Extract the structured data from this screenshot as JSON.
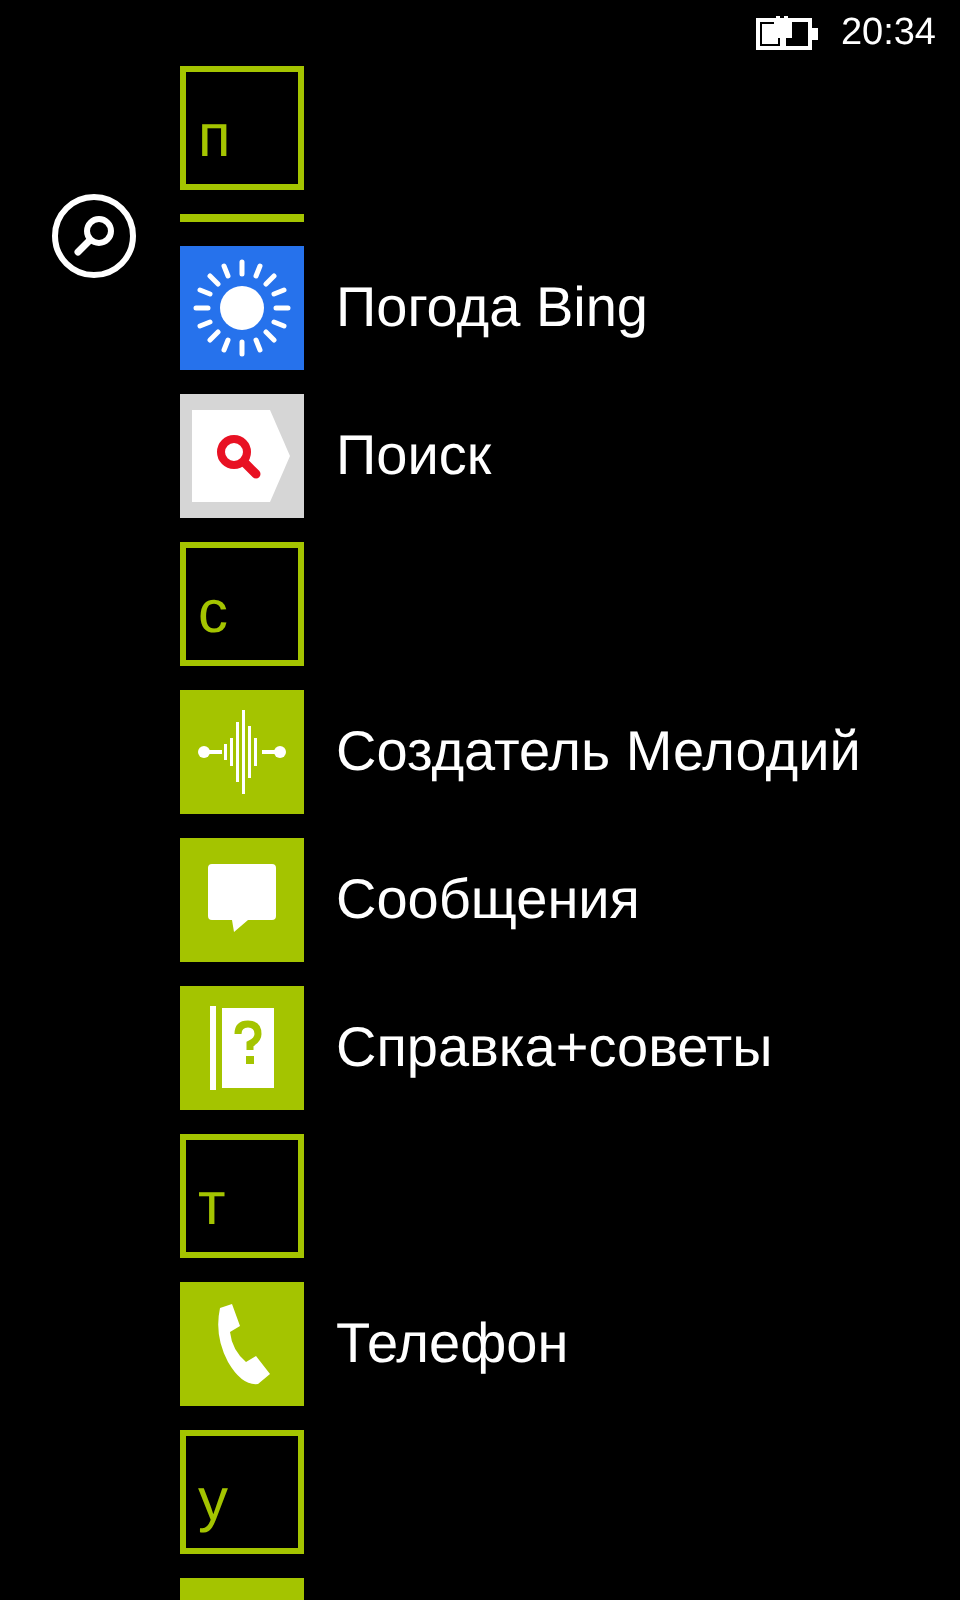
{
  "status_bar": {
    "time": "20:34"
  },
  "apps": [
    {
      "kind": "letter",
      "label": "п"
    },
    {
      "kind": "divider"
    },
    {
      "kind": "app",
      "label": "Погода Bing",
      "color": "#2672ec"
    },
    {
      "kind": "app",
      "label": "Поиск",
      "color": "#d6d6d6"
    },
    {
      "kind": "letter",
      "label": "с"
    },
    {
      "kind": "app",
      "label": "Создатель Мелодий",
      "color": "#a4c400"
    },
    {
      "kind": "app",
      "label": "Сообщения",
      "color": "#a4c400"
    },
    {
      "kind": "app",
      "label": "Справка+советы",
      "color": "#a4c400"
    },
    {
      "kind": "letter",
      "label": "т"
    },
    {
      "kind": "app",
      "label": "Телефон",
      "color": "#a4c400"
    },
    {
      "kind": "letter",
      "label": "у"
    },
    {
      "kind": "app",
      "color": "#a4c400"
    }
  ]
}
